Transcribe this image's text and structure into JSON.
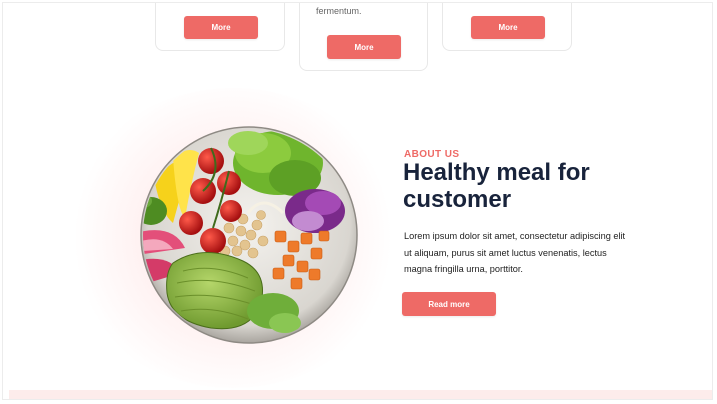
{
  "cards": [
    {
      "button_label": "More",
      "text": ""
    },
    {
      "button_label": "More",
      "text": "fermentum."
    },
    {
      "button_label": "More",
      "text": ""
    }
  ],
  "about": {
    "eyebrow": "ABOUT US",
    "title": "Healthy meal for customer",
    "description": "Lorem ipsum dolor sit amet, consectetur adipiscing elit ut aliquam, purus sit amet luctus venenatis, lectus magna fringilla urna, porttitor.",
    "button_label": "Read more"
  },
  "colors": {
    "accent": "#ee6a66",
    "heading": "#18233b",
    "band": "#fdeceb"
  }
}
